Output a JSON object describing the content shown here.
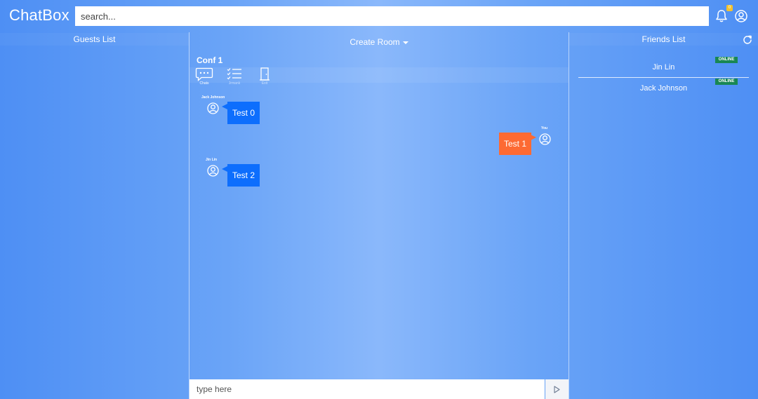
{
  "app": {
    "title": "ChatBox"
  },
  "header": {
    "search_placeholder": "search...",
    "notification_count": "0"
  },
  "guests": {
    "heading": "Guests List"
  },
  "friends": {
    "heading": "Friends List",
    "items": [
      {
        "name": "Jin Lin",
        "status": "ONLINE"
      },
      {
        "name": "Jack Johnson",
        "status": "ONLINE"
      }
    ]
  },
  "room": {
    "create_label": "Create Room",
    "title": "Conf 1",
    "tools": [
      {
        "label": "Chats",
        "icon": "chat-icon"
      },
      {
        "label": "Jrmank",
        "icon": "checklist-icon"
      },
      {
        "label": "Exit",
        "icon": "door-icon"
      }
    ]
  },
  "messages": [
    {
      "sender": "Jack Johnson",
      "text": "Test 0",
      "side": "left"
    },
    {
      "sender": "You",
      "text": "Test 1",
      "side": "right"
    },
    {
      "sender": "Jin Lin",
      "text": "Test 2",
      "side": "left"
    }
  ],
  "composer": {
    "placeholder": "type here"
  },
  "colors": {
    "own_bubble": "#fd6a33",
    "other_bubble": "#0d6efd",
    "online_badge": "#198754",
    "notification_badge": "#f2c230"
  }
}
